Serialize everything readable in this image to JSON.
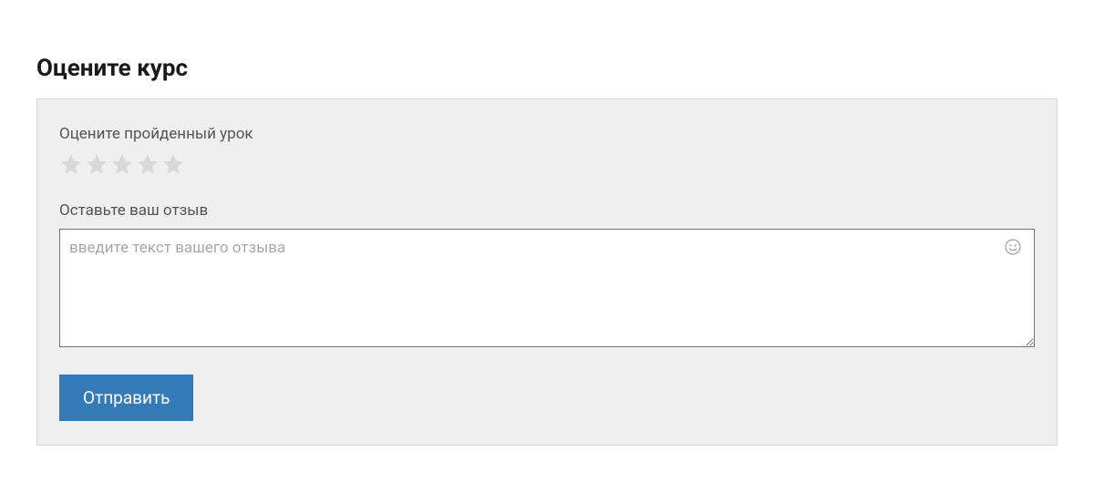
{
  "page": {
    "title": "Оцените курс"
  },
  "form": {
    "rating_label": "Оцените пройденный урок",
    "rating_value": 0,
    "rating_max": 5,
    "review_label": "Оставьте ваш отзыв",
    "review_placeholder": "введите текст вашего отзыва",
    "review_value": "",
    "submit_label": "Отправить"
  },
  "icons": {
    "star": "star-icon",
    "emoji": "smiley-icon"
  },
  "colors": {
    "accent": "#337ab7",
    "panel_bg": "#efefef",
    "panel_border": "#d5d5d5",
    "star_empty": "#d9d9d9"
  }
}
